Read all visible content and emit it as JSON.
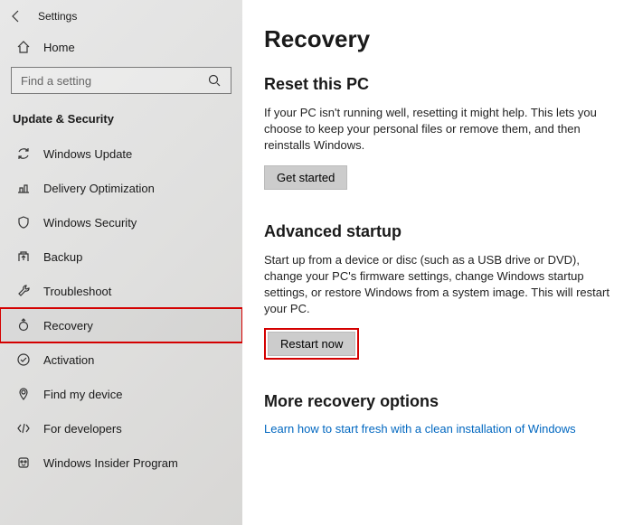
{
  "header": {
    "title": "Settings",
    "home": "Home"
  },
  "search": {
    "placeholder": "Find a setting"
  },
  "section_label": "Update & Security",
  "nav": {
    "items": [
      {
        "label": "Windows Update"
      },
      {
        "label": "Delivery Optimization"
      },
      {
        "label": "Windows Security"
      },
      {
        "label": "Backup"
      },
      {
        "label": "Troubleshoot"
      },
      {
        "label": "Recovery"
      },
      {
        "label": "Activation"
      },
      {
        "label": "Find my device"
      },
      {
        "label": "For developers"
      },
      {
        "label": "Windows Insider Program"
      }
    ]
  },
  "main": {
    "title": "Recovery",
    "reset": {
      "heading": "Reset this PC",
      "body": "If your PC isn't running well, resetting it might help. This lets you choose to keep your personal files or remove them, and then reinstalls Windows.",
      "button": "Get started"
    },
    "advanced": {
      "heading": "Advanced startup",
      "body": "Start up from a device or disc (such as a USB drive or DVD), change your PC's firmware settings, change Windows startup settings, or restore Windows from a system image. This will restart your PC.",
      "button": "Restart now"
    },
    "more": {
      "heading": "More recovery options",
      "link": "Learn how to start fresh with a clean installation of Windows"
    }
  }
}
